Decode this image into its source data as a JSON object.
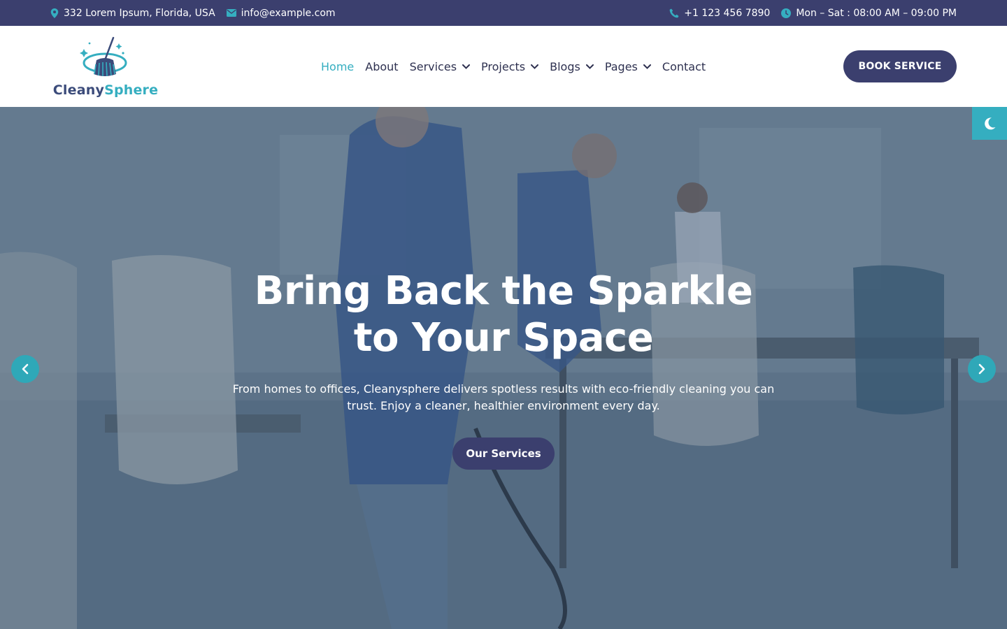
{
  "topbar": {
    "address": "332 Lorem Ipsum, Florida, USA",
    "email": "info@example.com",
    "phone": "+1 123 456 7890",
    "hours": "Mon – Sat : 08:00 AM – 09:00 PM"
  },
  "brand": {
    "name_part1": "Cleany",
    "name_part2": "Sphere"
  },
  "nav": {
    "items": [
      {
        "label": "Home",
        "active": true
      },
      {
        "label": "About"
      },
      {
        "label": "Services",
        "dropdown": true
      },
      {
        "label": "Projects",
        "dropdown": true
      },
      {
        "label": "Blogs",
        "dropdown": true
      },
      {
        "label": "Pages",
        "dropdown": true
      },
      {
        "label": "Contact"
      }
    ],
    "book_label": "BOOK SERVICE"
  },
  "hero": {
    "title": "Bring Back the Sparkle to Your Space",
    "subtitle": "From homes to offices, Cleanysphere delivers spotless results with eco-friendly cleaning you can trust. Enjoy a cleaner, healthier environment every day.",
    "cta_label": "Our Services"
  },
  "colors": {
    "brand_navy": "#3b3f6e",
    "accent_teal": "#35aec0"
  },
  "icons": {
    "address": "map-pin-icon",
    "email": "envelope-icon",
    "phone": "phone-icon",
    "hours": "clock-icon",
    "prev": "chevron-left-icon",
    "next": "chevron-right-icon",
    "theme": "moon-icon"
  }
}
